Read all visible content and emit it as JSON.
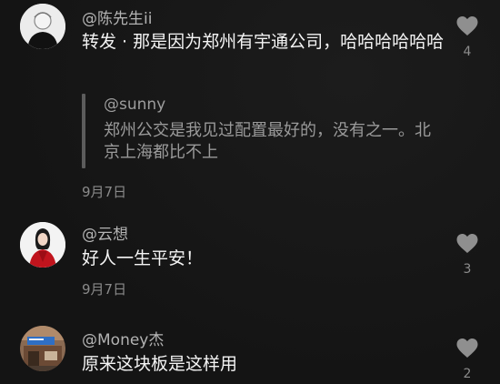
{
  "comments": [
    {
      "username": "@陈先生ii",
      "text": "转发 · 那是因为郑州有宇通公司，哈哈哈哈哈哈",
      "quote": {
        "username": "@sunny",
        "text": "郑州公交是我见过配置最好的，没有之一。北京上海都比不上"
      },
      "date": "9月7日",
      "like_count": "4"
    },
    {
      "username": "@云想",
      "text": "好人一生平安！",
      "date": "9月7日",
      "like_count": "3"
    },
    {
      "username": "@Money杰",
      "text": "原来这块板是这样用",
      "like_count": "2"
    }
  ],
  "colors": {
    "background": "#161616",
    "primary_text": "#f4f4f4",
    "secondary_text": "#b3b3b3",
    "date_text": "#8a8a8a",
    "like_icon": "#8f8f8f"
  },
  "icons": [
    "heart-icon"
  ]
}
